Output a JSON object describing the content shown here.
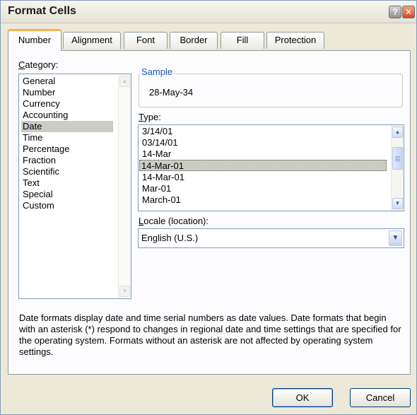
{
  "window": {
    "title": "Format Cells",
    "help_glyph": "?",
    "close_glyph": "✕"
  },
  "tabs": [
    {
      "label": "Number",
      "active": true
    },
    {
      "label": "Alignment",
      "active": false
    },
    {
      "label": "Font",
      "active": false
    },
    {
      "label": "Border",
      "active": false
    },
    {
      "label": "Fill",
      "active": false
    },
    {
      "label": "Protection",
      "active": false
    }
  ],
  "category": {
    "label_accel": "C",
    "label_rest": "ategory:",
    "items": [
      "General",
      "Number",
      "Currency",
      "Accounting",
      "Date",
      "Time",
      "Percentage",
      "Fraction",
      "Scientific",
      "Text",
      "Special",
      "Custom"
    ],
    "selected": "Date"
  },
  "sample": {
    "legend": "Sample",
    "value": "28-May-34"
  },
  "type": {
    "label_accel": "T",
    "label_rest": "ype:",
    "items": [
      "3/14/01",
      "03/14/01",
      "14-Mar",
      "14-Mar-01",
      "14-Mar-01",
      "Mar-01",
      "March-01"
    ],
    "selected_index": 3
  },
  "locale": {
    "label_accel": "L",
    "label_rest": "ocale (location):",
    "value": "English (U.S.)"
  },
  "description": "Date formats display date and time serial numbers as date values.  Date formats that begin with an asterisk (*) respond to changes in regional date and time settings that are specified for the operating system. Formats without an asterisk are not affected by operating system settings.",
  "buttons": {
    "ok": "OK",
    "cancel": "Cancel"
  },
  "colors": {
    "accent_tab": "#f7b24f",
    "legend_text": "#1a56b4",
    "selection": "#ccccc5"
  }
}
